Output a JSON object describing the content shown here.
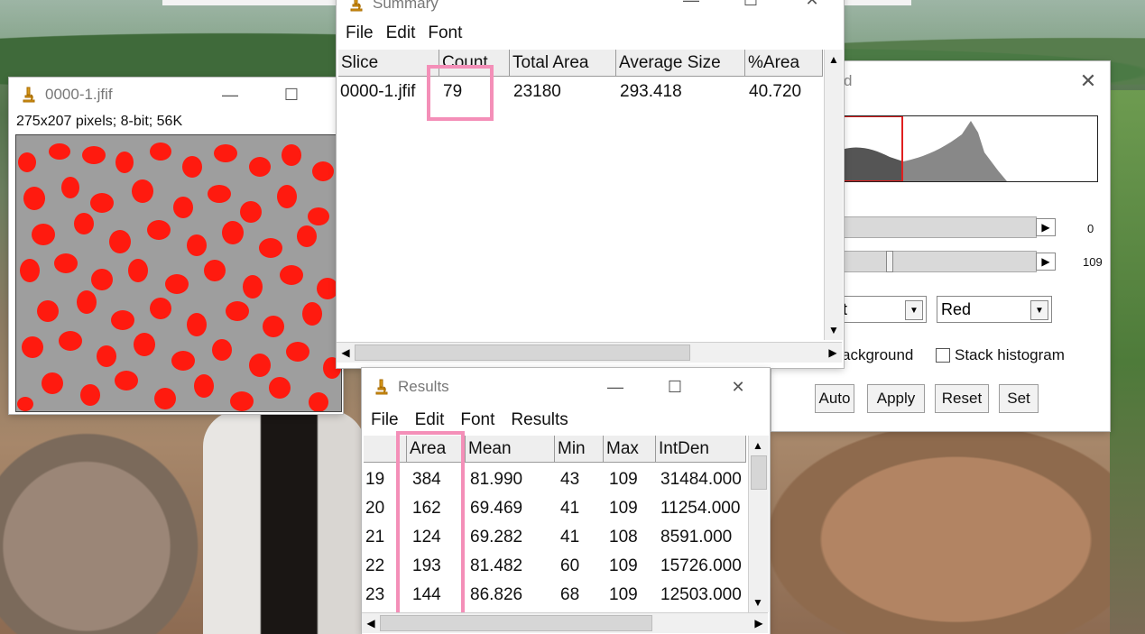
{
  "summary": {
    "title": "Summary",
    "menu": [
      "File",
      "Edit",
      "Font"
    ],
    "columns": [
      "Slice",
      "Count",
      "Total Area",
      "Average Size",
      "%Area"
    ],
    "row": {
      "slice": "0000-1.jfif",
      "count": "79",
      "total_area": "23180",
      "average_size": "293.418",
      "pct_area": "40.720"
    }
  },
  "image_window": {
    "title": "0000-1.jfif",
    "info": "275x207 pixels; 8-bit; 56K"
  },
  "threshold": {
    "title_fragment": "d",
    "slider1_value": "0",
    "slider2_value": "109",
    "method_fragment": "lt",
    "mode": "Red",
    "checkbox1_label_fragment": "ackground",
    "checkbox2_label": "Stack histogram",
    "buttons": [
      "Auto",
      "Apply",
      "Reset",
      "Set"
    ]
  },
  "results": {
    "title": "Results",
    "menu": [
      "File",
      "Edit",
      "Font",
      "Results"
    ],
    "columns": [
      "",
      "Area",
      "Mean",
      "Min",
      "Max",
      "IntDen"
    ],
    "rows": [
      [
        "19",
        "384",
        "81.990",
        "43",
        "109",
        "31484.000"
      ],
      [
        "20",
        "162",
        "69.469",
        "41",
        "109",
        "11254.000"
      ],
      [
        "21",
        "124",
        "69.282",
        "41",
        "108",
        "8591.000"
      ],
      [
        "22",
        "193",
        "81.482",
        "60",
        "109",
        "15726.000"
      ],
      [
        "23",
        "144",
        "86.826",
        "68",
        "109",
        "12503.000"
      ]
    ]
  },
  "colors": {
    "highlight": "#f48fb8",
    "particles": "#ff0000",
    "histogram_marker": "#e02020"
  }
}
